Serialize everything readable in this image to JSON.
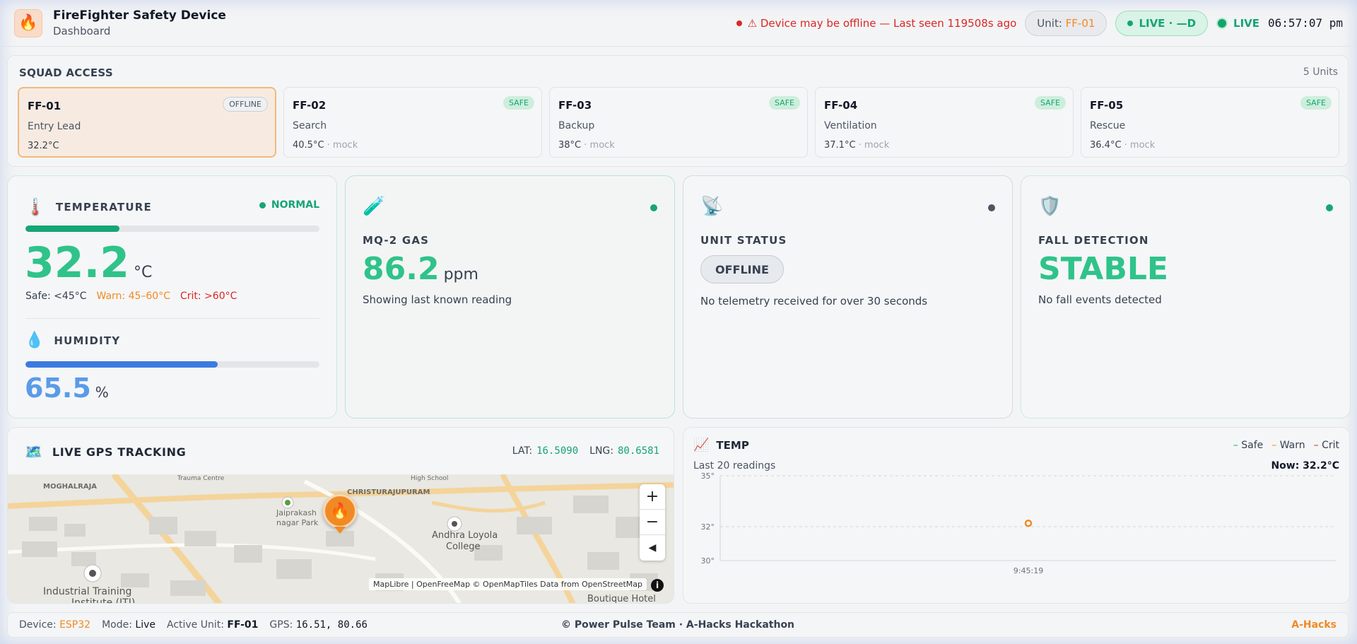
{
  "header": {
    "app_title": "FireFighter Safety Device",
    "subtitle": "Dashboard",
    "warning": "⚠ Device may be offline — Last seen 119508s ago",
    "unit_prefix": "Unit:",
    "unit_value": "FF-01",
    "live_pill": "LIVE · —D",
    "live_label": "LIVE",
    "clock": "06:57:07 pm"
  },
  "squad": {
    "title": "SQUAD ACCESS",
    "count": "5 Units",
    "units": [
      {
        "id": "FF-01",
        "role": "Entry Lead",
        "temp": "32.2°C",
        "mock": "",
        "status": "OFFLINE"
      },
      {
        "id": "FF-02",
        "role": "Search",
        "temp": "40.5°C",
        "mock": "· mock",
        "status": "SAFE"
      },
      {
        "id": "FF-03",
        "role": "Backup",
        "temp": "38°C",
        "mock": "· mock",
        "status": "SAFE"
      },
      {
        "id": "FF-04",
        "role": "Ventilation",
        "temp": "37.1°C",
        "mock": "· mock",
        "status": "SAFE"
      },
      {
        "id": "FF-05",
        "role": "Rescue",
        "temp": "36.4°C",
        "mock": "· mock",
        "status": "SAFE"
      }
    ]
  },
  "temperature": {
    "label": "TEMPERATURE",
    "status": "NORMAL",
    "value": "32.2",
    "unit": "°C",
    "level": 0.32,
    "safe": "Safe: <45°C",
    "warn": "Warn: 45–60°C",
    "crit": "Crit: >60°C"
  },
  "humidity": {
    "label": "HUMIDITY",
    "value": "65.5",
    "unit": "%",
    "level": 0.655
  },
  "gas": {
    "label": "MQ-2 GAS",
    "value": "86.2",
    "unit": "ppm",
    "note": "Showing last known reading"
  },
  "unit_status": {
    "label": "UNIT STATUS",
    "status": "OFFLINE",
    "note": "No telemetry received for over 30 seconds"
  },
  "fall": {
    "label": "FALL DETECTION",
    "status": "STABLE",
    "note": "No fall events detected"
  },
  "gps": {
    "title": "LIVE GPS TRACKING",
    "lat_label": "LAT:",
    "lat": "16.5090",
    "lng_label": "LNG:",
    "lng": "80.6581",
    "map_labels": {
      "trauma": "Trauma Centre",
      "high_school": "High School",
      "christuraju": "CHRISTURAJUPURAM",
      "moghalraja": "MOGHALRAJA",
      "park1": "Jaiprakash",
      "park2": "nagar Park",
      "college1": "Andhra Loyola",
      "college2": "College",
      "iti1": "Industrial Training",
      "iti2": "Institute (ITI)",
      "hotel": "Boutique Hotel"
    },
    "attribution": "MapLibre | OpenFreeMap © OpenMapTiles Data from OpenStreetMap",
    "zoom_in": "+",
    "zoom_out": "−"
  },
  "chart_data": {
    "type": "scatter",
    "title": "TEMP",
    "subtitle": "Last 20 readings",
    "now": "Now: 32.2°C",
    "legend": [
      "Safe",
      "Warn",
      "Crit"
    ],
    "legend_colors": [
      "#16a574",
      "#f08a24",
      "#dc2626"
    ],
    "yticks": [
      "35°",
      "32°",
      "30°"
    ],
    "ylim": [
      30,
      35
    ],
    "x": [
      "9:45:19"
    ],
    "values": [
      32.2
    ],
    "point_color": "#f08a24"
  },
  "footer": {
    "device_label": "Device:",
    "device": "ESP32",
    "mode_label": "Mode:",
    "mode": "Live",
    "active_label": "Active Unit:",
    "active": "FF-01",
    "gps_label": "GPS:",
    "gps": "16.51, 80.66",
    "credit": "© Power Pulse Team · A-Hacks Hackathon",
    "brand": "A-Hacks"
  },
  "colors": {
    "safe": "#16a574",
    "warn": "#f08a24",
    "crit": "#dc2626",
    "temp_value": "#2fc38a",
    "humidity": "#3b7be0",
    "gas": "#2fc38a"
  }
}
